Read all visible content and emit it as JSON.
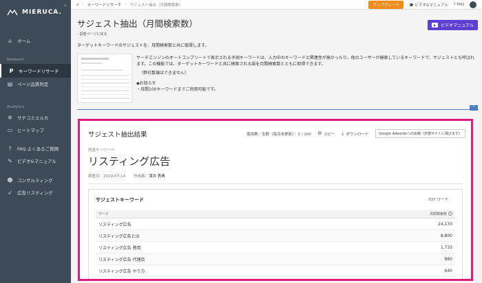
{
  "sidebar": {
    "collapse": "«",
    "logo": "MIERUCA.",
    "items_top": [
      {
        "label": "ホーム",
        "icon": "home-icon"
      }
    ],
    "section_research": "Research",
    "items_research": [
      {
        "label": "キーワードリサーチ",
        "icon": "keyword-icon",
        "active": true
      },
      {
        "label": "ページ品質判定",
        "icon": "page-quality-icon"
      }
    ],
    "section_analytics": "Analytics",
    "items_analytics": [
      {
        "label": "サチコミエルカ",
        "icon": "gear-icon"
      },
      {
        "label": "ヒートマップ",
        "icon": "monitor-icon"
      }
    ],
    "items_support": [
      {
        "label": "FAQ よくあるご質問",
        "icon": "question-icon"
      },
      {
        "label": "ビデオ&マニュアル",
        "icon": "pencil-icon"
      }
    ],
    "items_bottom": [
      {
        "label": "コンサルティング",
        "icon": "users-icon"
      },
      {
        "label": "広告リスティング",
        "icon": "rocket-icon"
      }
    ]
  },
  "topbar": {
    "crumb1": "キーワードリサーチ",
    "crumb2": "サジェスト抽出（月間検索数）",
    "upgrade": "アップグレード",
    "video_manual": "ビデオ&マニュアル",
    "faq": "FAQ"
  },
  "page": {
    "title": "サジェスト抽出（月間検索数）",
    "back": "‹ 調査ページに戻る",
    "video_button": "ビデオマニュアル",
    "description": "ターゲットキーワードのサジェストを、月間検索数と共に取得します。",
    "intro": "サーチエンジンのオートコンプリートで表示される予測キーワードは、入力中のキーワードと関連性が高かったり、他のユーザーが検索しているキーワードで、サジェストとも呼ばれます。この機能では、ターゲットキーワードと共に検索される語を月間検索数とともに取得できます。",
    "note1": "（弊社数値はできません）",
    "notice_heading": "◆お知らせ",
    "notice_body": "・月間100キーワードまでご利用可能です。"
  },
  "result": {
    "title": "サジェスト抽出結果",
    "usage": "使用数／全数（毎月末更新）：1 / 100",
    "copy": "コピー",
    "download": "ダウンロード",
    "external": "Google Adwordsへの出稿（外部サイトに飛びます）",
    "kw_label": "調査キーワード",
    "keyword": "リスティング広告",
    "date_label": "調査日：",
    "date": "2020-07-14",
    "author_label": "作成者：",
    "author": "滝井 秀典",
    "table_title": "サジェストキーワード",
    "count": "537 ワード",
    "col_word": "ワード",
    "col_volume": "月間検索数",
    "rows": [
      {
        "word": "リスティング広告",
        "volume": "24,133"
      },
      {
        "word": "リスティング広告とは",
        "volume": "8,800"
      },
      {
        "word": "リスティング広告 費用",
        "volume": "1,733"
      },
      {
        "word": "リスティング広告 代理店",
        "volume": "960"
      },
      {
        "word": "リスティング広告 やり方",
        "volume": "640"
      }
    ]
  },
  "colors": {
    "sidebar": "#3d4a57",
    "highlight": "#e0197d",
    "upgrade": "#f08b1c",
    "video": "#5d3fd3",
    "accent_blue": "#4a7fc1"
  }
}
